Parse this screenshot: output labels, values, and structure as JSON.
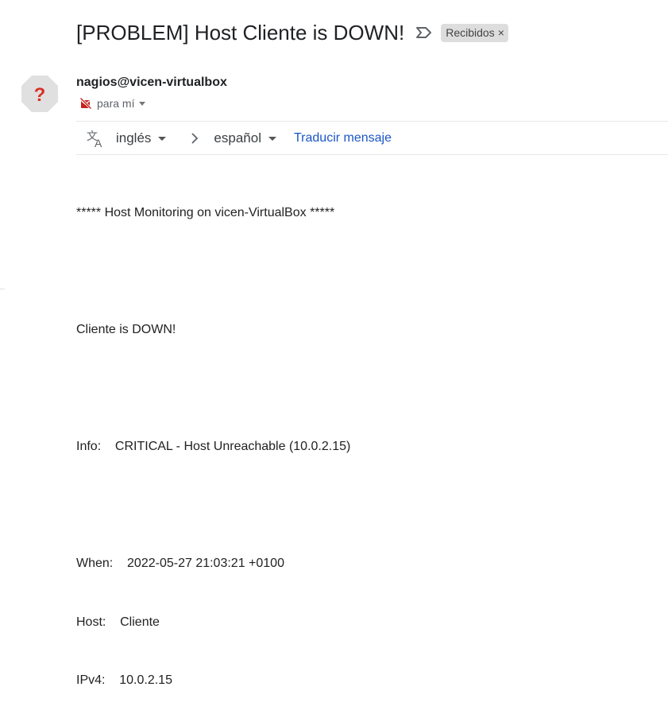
{
  "email": {
    "subject": "[PROBLEM] Host Cliente is DOWN!",
    "label_chip": {
      "text": "Recibidos",
      "close_glyph": "×"
    },
    "important_icon": "label-important-outline-icon"
  },
  "sender": {
    "name": "nagios@vicen-virtualbox",
    "avatar_glyph": "?",
    "avatar_color": "#e0e0e0",
    "avatar_glyph_color": "#d93025",
    "recipient_text": "para mí",
    "unencrypted_icon": "unencrypted-icon"
  },
  "translate_bar": {
    "icon": "translate-icon",
    "from_language": "inglés",
    "arrow": "chevron-right-icon",
    "to_language": "español",
    "translate_link": "Traducir mensaje",
    "link_color": "#1a56c4"
  },
  "message_body": {
    "line_1": "***** Host Monitoring on vicen-VirtualBox *****",
    "line_2": "Cliente is DOWN!",
    "line_3": "Info:    CRITICAL - Host Unreachable (10.0.2.15)",
    "line_4": "When:    2022-05-27 21:03:21 +0100",
    "line_5": "Host:    Cliente",
    "line_6": "IPv4:    10.0.2.15"
  }
}
